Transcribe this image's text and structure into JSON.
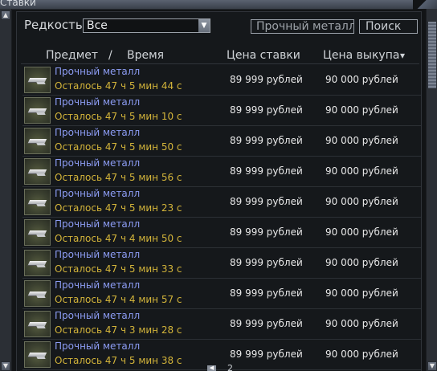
{
  "window": {
    "title": "Ставки"
  },
  "filter": {
    "rarity_label": "Редкость",
    "rarity_value": "Все",
    "search_value": "Прочный металл",
    "search_button": "Поиск"
  },
  "columns": {
    "item": "Предмет",
    "separator": "/",
    "time": "Время",
    "bid": "Цена ставки",
    "buyout": "Цена выкупа",
    "sort_indicator": "▾"
  },
  "rows": [
    {
      "name": "Прочный металл",
      "time_left": "Осталось 47 ч 5 мин 44 с",
      "bid": "89 999 рублей",
      "buyout": "90 000 рублей"
    },
    {
      "name": "Прочный металл",
      "time_left": "Осталось 47 ч 5 мин 10 с",
      "bid": "89 999 рублей",
      "buyout": "90 000 рублей"
    },
    {
      "name": "Прочный металл",
      "time_left": "Осталось 47 ч 5 мин 50 с",
      "bid": "89 999 рублей",
      "buyout": "90 000 рублей"
    },
    {
      "name": "Прочный металл",
      "time_left": "Осталось 47 ч 5 мин 56 с",
      "bid": "89 999 рублей",
      "buyout": "90 000 рублей"
    },
    {
      "name": "Прочный металл",
      "time_left": "Осталось 47 ч 5 мин 23 с",
      "bid": "89 999 рублей",
      "buyout": "90 000 рублей"
    },
    {
      "name": "Прочный металл",
      "time_left": "Осталось 47 ч 4 мин 50 с",
      "bid": "89 999 рублей",
      "buyout": "90 000 рублей"
    },
    {
      "name": "Прочный металл",
      "time_left": "Осталось 47 ч 5 мин 33 с",
      "bid": "89 999 рублей",
      "buyout": "90 000 рублей"
    },
    {
      "name": "Прочный металл",
      "time_left": "Осталось 47 ч 4 мин 57 с",
      "bid": "89 999 рублей",
      "buyout": "90 000 рублей"
    },
    {
      "name": "Прочный металл",
      "time_left": "Осталось 47 ч 3 мин 28 с",
      "bid": "89 999 рублей",
      "buyout": "90 000 рублей"
    },
    {
      "name": "Прочный металл",
      "time_left": "Осталось 47 ч 5 мин 38 с",
      "bid": "89 999 рублей",
      "buyout": "90 000 рублей"
    }
  ],
  "pager": {
    "page": "2"
  },
  "icons": {
    "item": "metal-bar-icon",
    "select_arrow": "chevron-down-icon",
    "scroll_up": "arrow-up-icon",
    "scroll_down": "arrow-down-icon",
    "pager_prev": "arrow-left-icon"
  },
  "colors": {
    "item_name": "#8c9cf3",
    "time_left": "#d3b43a",
    "price": "#e8e8e8",
    "background": "#15181b"
  }
}
